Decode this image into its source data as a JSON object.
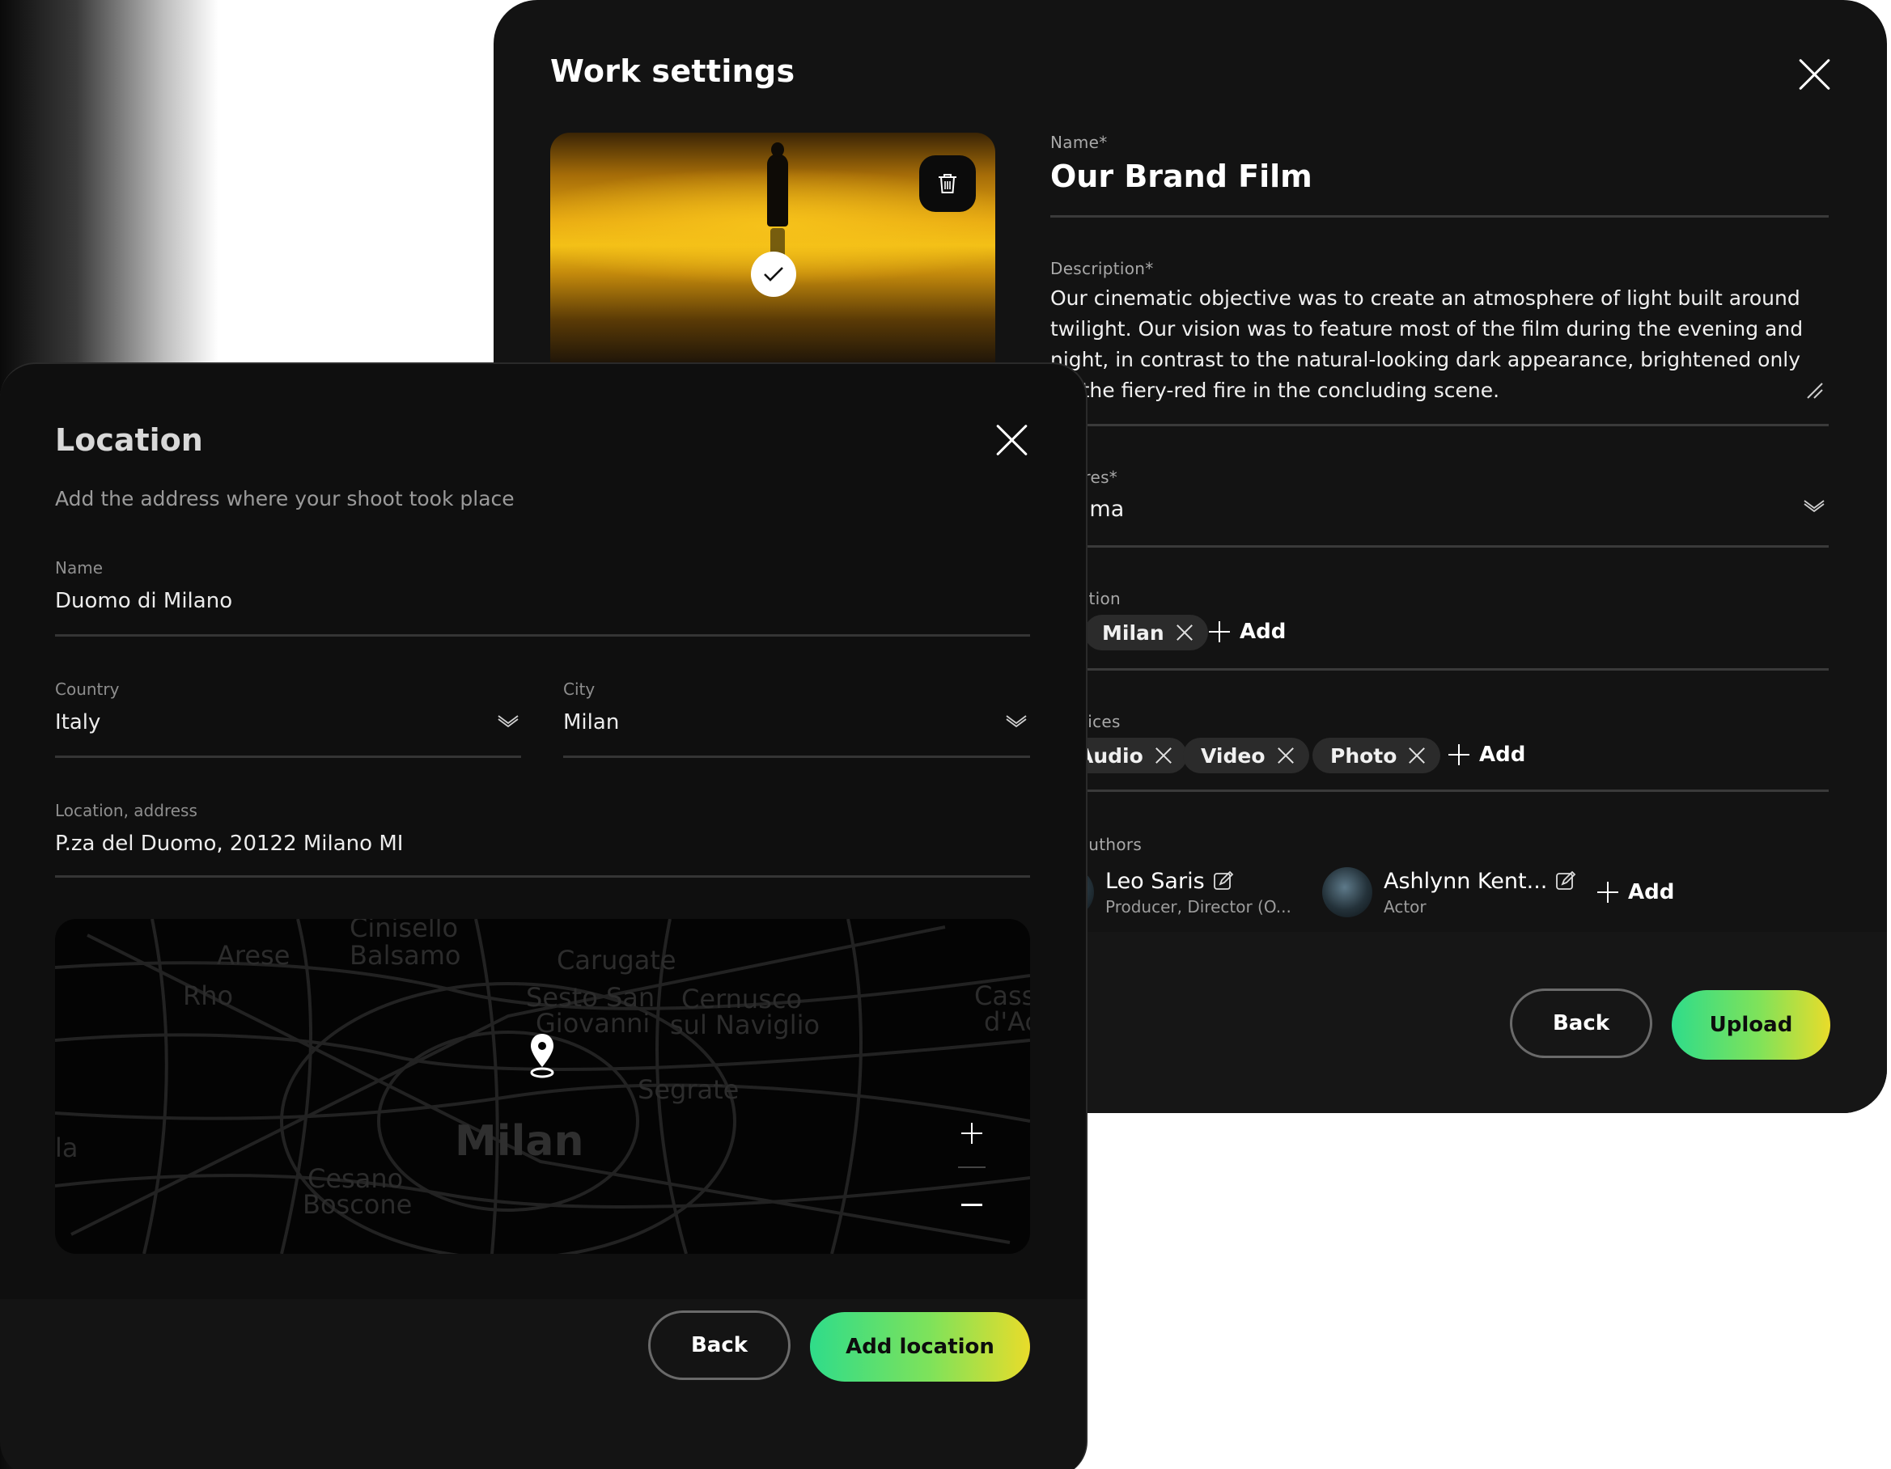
{
  "work": {
    "title": "Work settings",
    "name_label": "Name*",
    "name_value": "Our Brand Film",
    "description_label": "Description*",
    "description_value": "Our cinematic objective was to create an atmosphere of light built around twilight. Our vision was to feature most of the film during the evening and night, in contrast to the natural-looking dark appearance, brightened only by the fiery-red fire in the concluding scene.",
    "genres_label": "Genres*",
    "genres_value": "Drama",
    "location_label": "Location",
    "location_chips": [
      "Milan"
    ],
    "services_label": "Services",
    "services_chips": [
      "Audio",
      "Video",
      "Photo"
    ],
    "add_label": "Add",
    "authors_label": "Co-authors",
    "authors": [
      {
        "name": "Leo Saris",
        "role": "Producer, Director (O..."
      },
      {
        "name": "Ashlynn Kent...",
        "role": "Actor"
      }
    ],
    "back_label": "Back",
    "upload_label": "Upload"
  },
  "location": {
    "title": "Location",
    "subtitle": "Add the address where your shoot took place",
    "name_label": "Name",
    "name_value": "Duomo di Milano",
    "country_label": "Country",
    "country_value": "Italy",
    "city_label": "City",
    "city_value": "Milan",
    "address_label": "Location, address",
    "address_value": "P.za del Duomo, 20122 Milano MI",
    "map_labels": {
      "cinisello": "Cinisello",
      "balsamo": "Balsamo",
      "arese": "Arese",
      "rho": "Rho",
      "carugate": "Carugate",
      "sesto": "Sesto San",
      "giovanni": "Giovanni",
      "cernusco": "Cernusco",
      "naviglio": "sul Naviglio",
      "cassano": "Cass",
      "adda": "d'Ac",
      "segrate": "Segrate",
      "milan": "Milan",
      "cesano": "Cesano",
      "boscone": "Boscone",
      "left_edge": "la"
    },
    "back_label": "Back",
    "add_location_label": "Add location"
  },
  "icons": {
    "close": "close-icon",
    "trash": "trash-icon",
    "check": "check-icon",
    "chevron": "chevron-down-icon",
    "plus": "plus-icon",
    "edit": "edit-icon",
    "pin": "map-pin-icon"
  },
  "colors": {
    "panel_bg": "#131313",
    "accent_gradient_start": "#2fdc8a",
    "accent_gradient_end": "#e9dc2a"
  }
}
